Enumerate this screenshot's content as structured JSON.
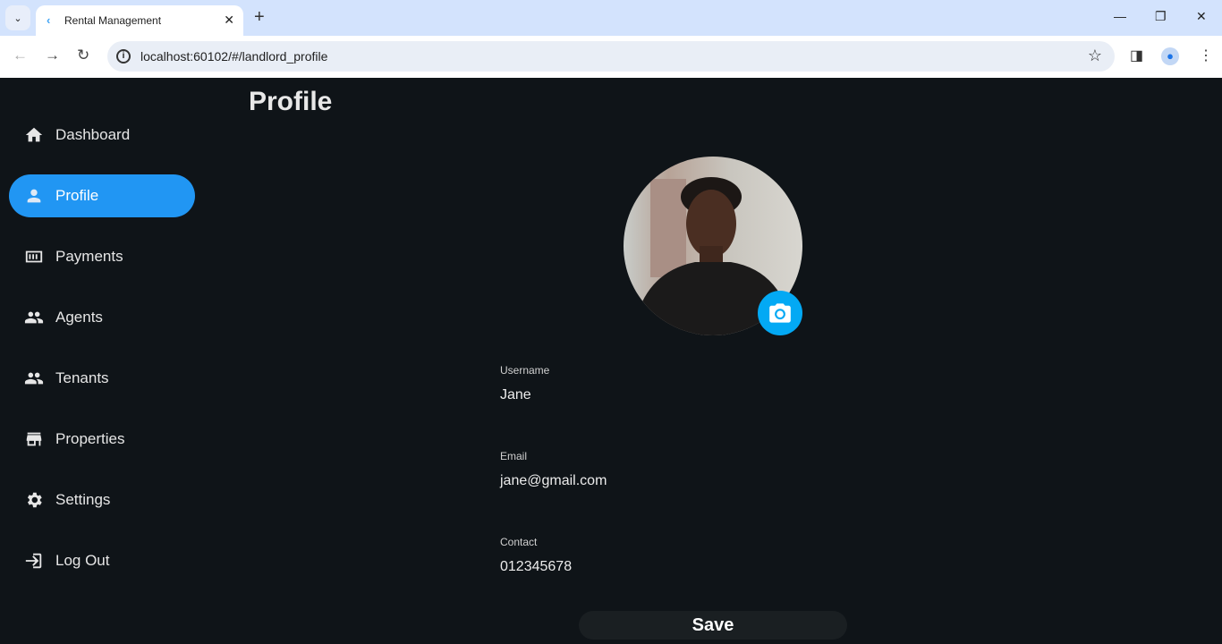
{
  "browser": {
    "tab_title": "Rental Management",
    "url": "localhost:60102/#/landlord_profile"
  },
  "sidebar": {
    "items": [
      {
        "label": "Dashboard",
        "icon": "home-icon"
      },
      {
        "label": "Profile",
        "icon": "person-icon",
        "active": true
      },
      {
        "label": "Payments",
        "icon": "payments-icon"
      },
      {
        "label": "Agents",
        "icon": "people-icon"
      },
      {
        "label": "Tenants",
        "icon": "people-icon"
      },
      {
        "label": "Properties",
        "icon": "store-icon"
      },
      {
        "label": "Settings",
        "icon": "gear-icon"
      },
      {
        "label": "Log Out",
        "icon": "logout-icon"
      }
    ]
  },
  "page": {
    "title": "Profile",
    "fields": [
      {
        "label": "Username",
        "value": "Jane"
      },
      {
        "label": "Email",
        "value": "jane@gmail.com"
      },
      {
        "label": "Contact",
        "value": "012345678"
      }
    ],
    "save_label": "Save"
  },
  "colors": {
    "accent": "#2196f3",
    "camera": "#03a9f4",
    "background": "#0f1418"
  }
}
